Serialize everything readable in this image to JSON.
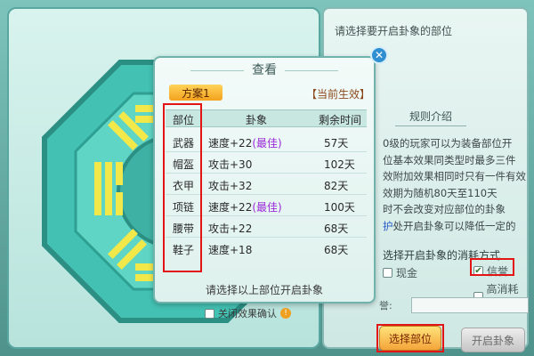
{
  "right_panel": {
    "prompt": "请选择要开启卦象的部位",
    "rules_title": "规则介绍",
    "rules_lines": [
      "0级的玩家可以为装备部位开",
      "位基本效果同类型时最多三件",
      "效附加效果相同时只有一件有效",
      "效期为随机80天至110天",
      "时不会改变对应部位的卦象",
      "护处开启卦象可以降低一定的"
    ],
    "rules_highlight": "护",
    "cost_title": "选择开启卦象的消耗方式",
    "options": [
      {
        "label": "现金",
        "checked": false
      },
      {
        "label": "信誉",
        "checked": true
      },
      {
        "label": "高消耗模",
        "checked": false
      }
    ],
    "partial_label": "誉:"
  },
  "buttons": {
    "select_part": "选择部位",
    "open_hexagram": "开启卦象"
  },
  "modal": {
    "title": "查看",
    "plan": "方案1",
    "current_effect": "【当前生效】",
    "columns": [
      "部位",
      "卦象",
      "剩余时间"
    ],
    "rows": [
      {
        "part": "武器",
        "effect": "速度+22",
        "best": "(最佳)",
        "time": "57天"
      },
      {
        "part": "帽盔",
        "effect": "攻击+30",
        "best": "",
        "time": "102天"
      },
      {
        "part": "衣甲",
        "effect": "攻击+32",
        "best": "",
        "time": "82天"
      },
      {
        "part": "项链",
        "effect": "速度+22",
        "best": "(最佳)",
        "time": "100天"
      },
      {
        "part": "腰带",
        "effect": "攻击+22",
        "best": "",
        "time": "68天"
      },
      {
        "part": "鞋子",
        "effect": "速度+18",
        "best": "",
        "time": "68天"
      }
    ],
    "footer": "请选择以上部位开启卦象",
    "close_icon": "close-icon"
  },
  "below_modal": {
    "checkbox_label": "关闭效果确认"
  },
  "colors": {
    "highlight_box": "#e21414",
    "best": "#9b28d8",
    "plan_badge": "#f3a21d"
  }
}
